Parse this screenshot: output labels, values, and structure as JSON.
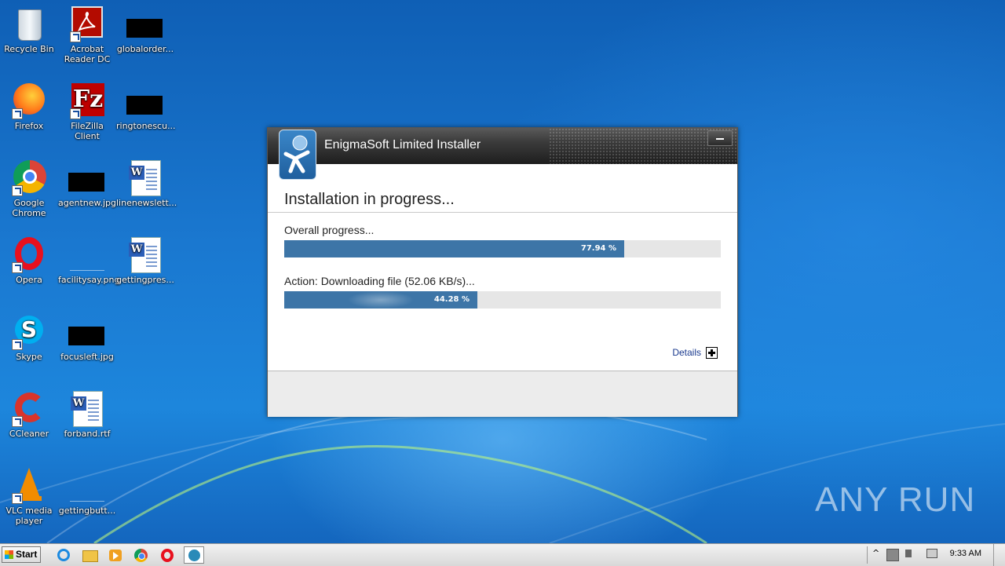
{
  "desktop": {
    "icons": [
      {
        "label": "Recycle Bin",
        "icon": "recycle-bin-icon"
      },
      {
        "label": "Acrobat Reader DC",
        "icon": "acrobat-icon"
      },
      {
        "label": "globalorder...",
        "icon": "image-file-icon"
      },
      {
        "label": "Firefox",
        "icon": "firefox-icon"
      },
      {
        "label": "FileZilla Client",
        "icon": "filezilla-icon"
      },
      {
        "label": "ringtonescu...",
        "icon": "image-file-icon"
      },
      {
        "label": "Google Chrome",
        "icon": "chrome-icon"
      },
      {
        "label": "agentnew.jpg",
        "icon": "image-file-icon"
      },
      {
        "label": "linenewslett...",
        "icon": "word-doc-icon"
      },
      {
        "label": "Opera",
        "icon": "opera-icon"
      },
      {
        "label": "facilitysay.png",
        "icon": "image-file-icon"
      },
      {
        "label": "gettingpres...",
        "icon": "word-doc-icon"
      },
      {
        "label": "Skype",
        "icon": "skype-icon"
      },
      {
        "label": "focusleft.jpg",
        "icon": "image-file-icon"
      },
      {
        "label": "CCleaner",
        "icon": "ccleaner-icon"
      },
      {
        "label": "forband.rtf",
        "icon": "word-doc-icon"
      },
      {
        "label": "VLC media player",
        "icon": "vlc-icon"
      },
      {
        "label": "gettingbutt...",
        "icon": "image-file-icon"
      }
    ]
  },
  "installer": {
    "title": "EnigmaSoft Limited Installer",
    "heading": "Installation in progress...",
    "overall_label": "Overall progress...",
    "overall_percent_text": "77.94 %",
    "overall_fraction": 0.7794,
    "action_label": "Action: Downloading file (52.06 KB/s)...",
    "action_percent_text": "44.28 %",
    "action_fraction": 0.4428,
    "details_label": "Details"
  },
  "watermark": {
    "text": "ANY RUN"
  },
  "taskbar": {
    "start_label": "Start",
    "clock": "9:33 AM",
    "pinned": [
      "ie-icon",
      "explorer-icon",
      "media-player-icon",
      "chrome-icon",
      "opera-icon",
      "installer-icon"
    ]
  },
  "colors": {
    "progress_fill": "#3d75a7",
    "progress_track": "#e6e6e6",
    "link": "#1a3a8f"
  }
}
